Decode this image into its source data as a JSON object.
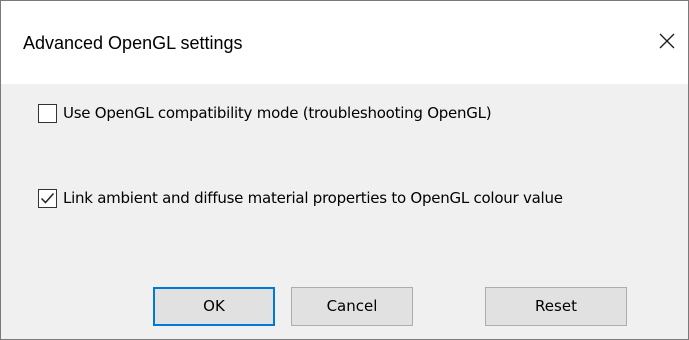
{
  "window": {
    "title": "Advanced OpenGL settings",
    "close_icon": "close-icon"
  },
  "options": [
    {
      "label": "Use OpenGL compatibility mode (troubleshooting OpenGL)",
      "checked": false
    },
    {
      "label": "Link ambient and diffuse material properties to OpenGL colour value",
      "checked": true
    }
  ],
  "buttons": {
    "ok_label": "OK",
    "cancel_label": "Cancel",
    "reset_label": "Reset"
  },
  "colors": {
    "accent": "#0078d7",
    "dialog_background": "#f0f0f0",
    "titlebar_background": "#ffffff",
    "button_background": "#e1e1e1"
  }
}
